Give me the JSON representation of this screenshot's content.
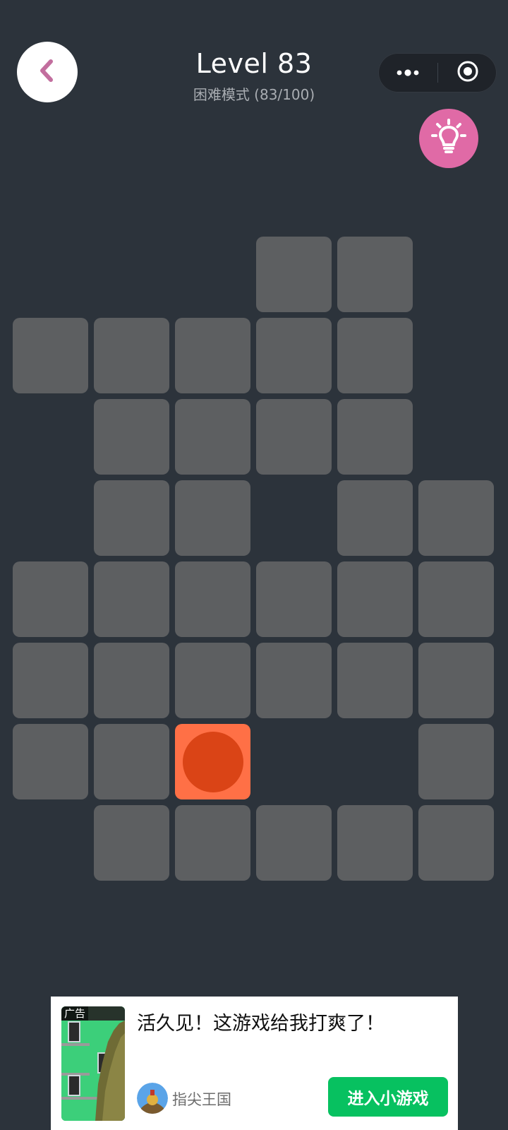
{
  "header": {
    "level_title": "Level 83",
    "mode_progress": "困难模式 (83/100)"
  },
  "icons": {
    "back": "chevron-left-icon",
    "more": "more-dots-icon",
    "close": "target-close-icon",
    "hint": "lightbulb-icon"
  },
  "colors": {
    "background": "#2c333b",
    "tile": "#5d5f61",
    "active_tile": "#ff7046",
    "ball": "#da4416",
    "hint_button": "#e06aa6",
    "back_chevron": "#c26e9e",
    "ad_cta": "#07c160"
  },
  "board": {
    "rows": 8,
    "cols": 6,
    "grid": [
      "...XX.",
      "XXXXX.",
      ".XXXX.",
      ".XX.XX",
      "XXXXXX",
      "XXXXXX",
      "XXA..X",
      ".XXXXX"
    ],
    "ball_row": 6,
    "ball_col": 2
  },
  "ad": {
    "badge": "广告",
    "headline": "活久见！这游戏给我打爽了！",
    "app_name": "指尖王国",
    "cta_label": "进入小游戏"
  }
}
